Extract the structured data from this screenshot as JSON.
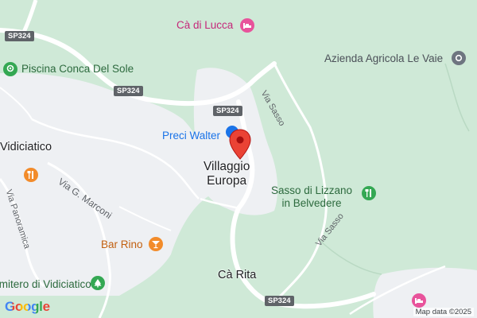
{
  "places": {
    "vidiciatico": "Vidiciatico",
    "villaggio_line1": "Villaggio",
    "villaggio_line2": "Europa",
    "ca_rita": "Cà Rita"
  },
  "pois": {
    "ca_di_lucca": "Cà di Lucca",
    "piscina": "Piscina Conca Del Sole",
    "azienda": "Azienda Agricola Le Vaie",
    "preci_walter": "Preci Walter",
    "sasso_line1": "Sasso di Lizzano",
    "sasso_line2": "in Belvedere",
    "bar_rino": "Bar Rino",
    "cimitero": "Cimitero di Vidiciatico"
  },
  "roads": {
    "sp324": "SP324",
    "via_sasso": "Via Sasso",
    "via_marconi": "Via G. Marconi",
    "via_panoramica": "Via Panoramica"
  },
  "footer": {
    "attribution": "Map data ©2025",
    "logo": "Google"
  },
  "colors": {
    "forest": "#cfe9d7",
    "urban": "#eef0f3",
    "road": "#ffffff",
    "marker": "#ea4335",
    "lodging": "#e8539b",
    "park": "#34a853"
  }
}
